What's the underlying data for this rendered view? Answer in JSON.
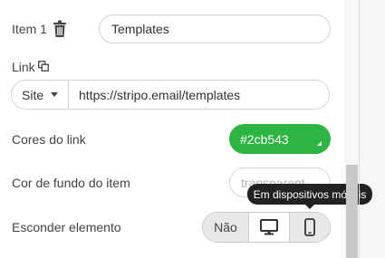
{
  "item": {
    "label": "Item 1",
    "name_value": "Templates",
    "icon": "trash-icon"
  },
  "link": {
    "label": "Link",
    "icon": "copy-icon",
    "type_options_selected": "Site",
    "url_value": "https://stripo.email/templates"
  },
  "link_colors": {
    "label": "Cores do link",
    "value": "#2cb543",
    "color": "#2cb543"
  },
  "item_background": {
    "label": "Cor de fundo do item",
    "placeholder": "transparent"
  },
  "hide_element": {
    "label": "Esconder elemento",
    "options": [
      {
        "label": "Não",
        "icon": null
      },
      {
        "label": "",
        "icon": "desktop-icon"
      },
      {
        "label": "",
        "icon": "mobile-icon"
      }
    ],
    "tooltip": "Em dispositivos móveis"
  }
}
